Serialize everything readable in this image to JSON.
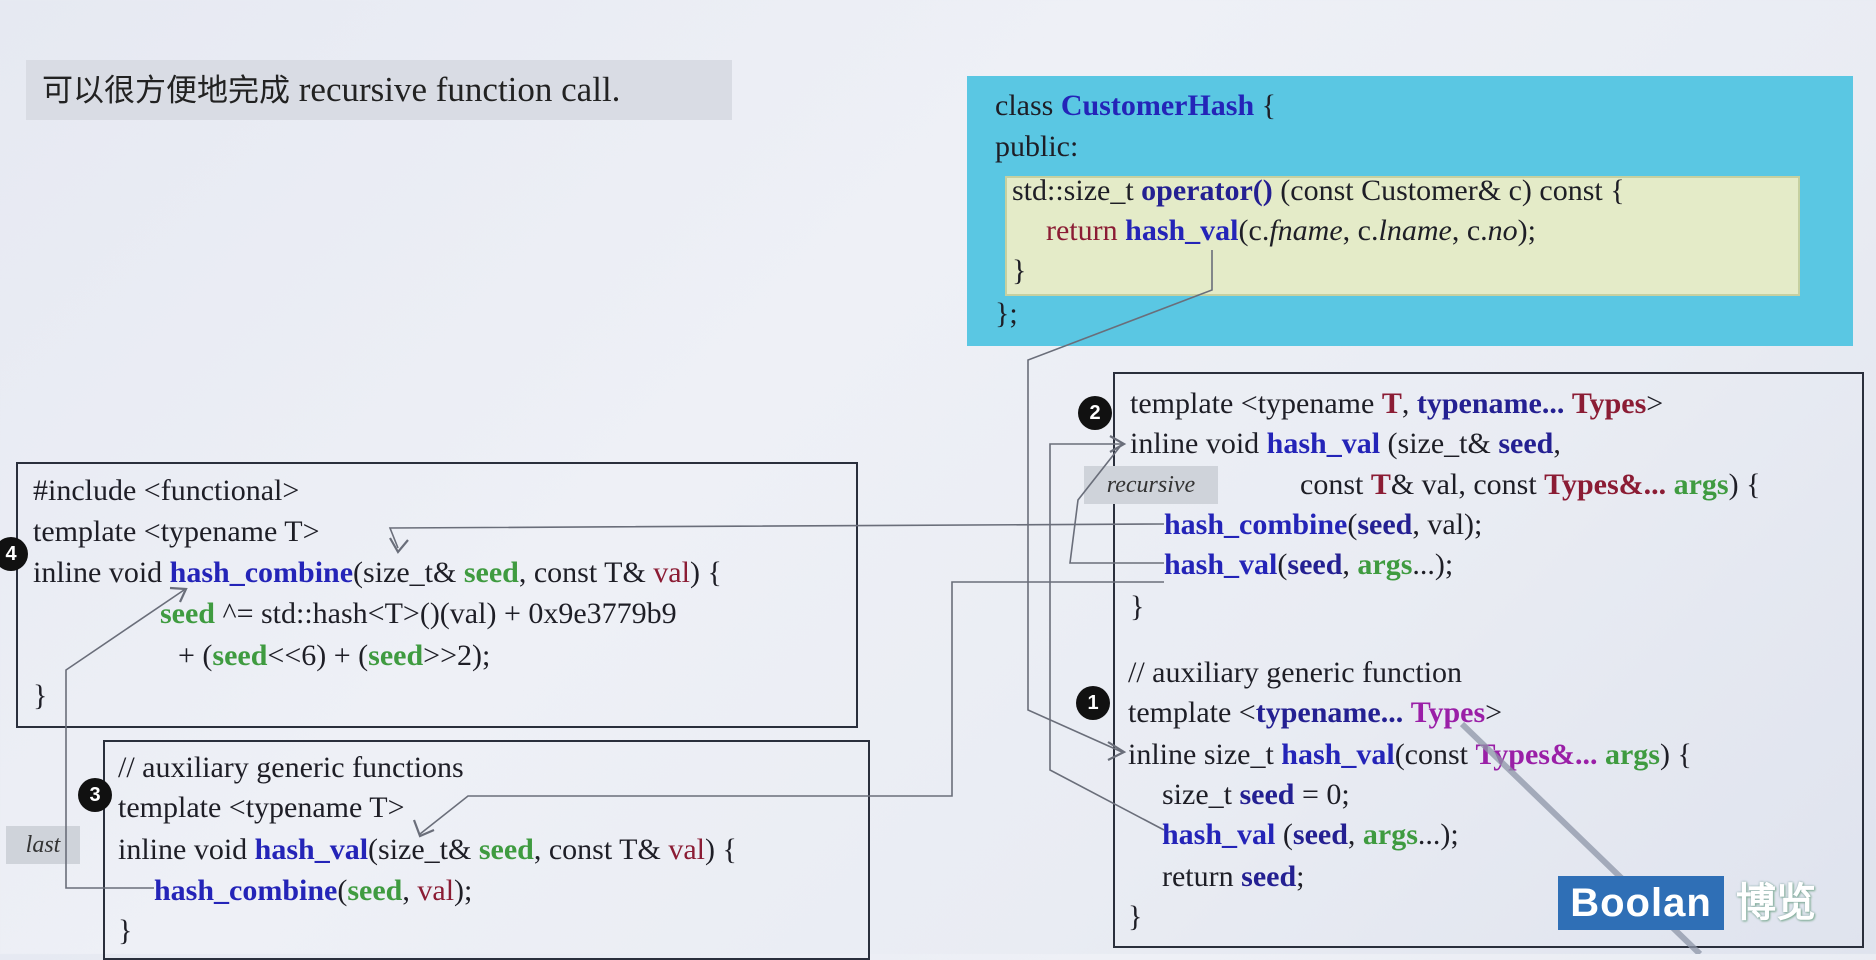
{
  "heading": {
    "cjk": "可以很方便地完成",
    "latin": " recursive function call."
  },
  "customer_hash": {
    "l1_a": "class ",
    "l1_b": "CustomerHash",
    "l1_c": " {",
    "l2": "public:",
    "l3_a": "std::size_t ",
    "l3_b": "operator()",
    "l3_c": " (const Customer& c) const {",
    "l4_a": "return ",
    "l4_b": "hash_val",
    "l4_c": "(c.",
    "l4_d": "fname",
    "l4_e": ", c.",
    "l4_f": "lname",
    "l4_g": ", c.",
    "l4_h": "no",
    "l4_i": ");",
    "l5": "}",
    "l6": "};"
  },
  "box2": {
    "badge": "2",
    "l1_a": "template <typename ",
    "l1_b": "T",
    "l1_c": ", ",
    "l1_d": "typename...",
    "l1_e": " ",
    "l1_f": "Types",
    "l1_g": ">",
    "l2_a": "inline void ",
    "l2_b": "hash_val",
    "l2_c": " (size_t& ",
    "l2_d": "seed",
    "l2_e": ",",
    "l3_a": "const ",
    "l3_b": "T",
    "l3_c": "& val, const ",
    "l3_d": "Types&...",
    "l3_e": " ",
    "l3_f": "args",
    "l3_g": ") {",
    "l4_a": "hash_combine",
    "l4_b": "(",
    "l4_c": "seed",
    "l4_d": ", val);",
    "l5_a": "hash_val",
    "l5_b": "(",
    "l5_c": "seed",
    "l5_d": ", ",
    "l5_e": "args",
    "l5_f": "...);",
    "l6": "}"
  },
  "recursive_tag": "recursive",
  "box1": {
    "badge": "1",
    "l1": "// auxiliary generic function",
    "l2_a": "template <",
    "l2_b": "typename...",
    "l2_c": " ",
    "l2_d": "Types",
    "l2_e": ">",
    "l3_a": "inline size_t ",
    "l3_b": "hash_val",
    "l3_c": "(const ",
    "l3_d": "Types&...",
    "l3_e": " ",
    "l3_f": "args",
    "l3_g": ") {",
    "l4_a": "size_t ",
    "l4_b": "seed",
    "l4_c": " = 0;",
    "l5_a": "hash_val",
    "l5_b": " (",
    "l5_c": "seed",
    "l5_d": ", ",
    "l5_e": "args",
    "l5_f": "...);",
    "l6_a": "return ",
    "l6_b": "seed",
    "l6_c": ";",
    "l7": "}"
  },
  "box4": {
    "badge": "4",
    "l1": "#include <functional>",
    "l2": "template <typename T>",
    "l3_a": "inline void ",
    "l3_b": "hash_combine",
    "l3_c": "(size_t& ",
    "l3_d": "seed",
    "l3_e": ", const T& ",
    "l3_f": "val",
    "l3_g": ") {",
    "l4_a": "seed",
    "l4_b": " ^= std::hash<T>()(val) + 0x9e3779b9",
    "l5_a": "+ (",
    "l5_b": "seed",
    "l5_c": "<<6) + (",
    "l5_d": "seed",
    "l5_e": ">>2);",
    "l6": "}"
  },
  "box3": {
    "badge": "3",
    "l1": "// auxiliary generic functions",
    "l2": "template <typename T>",
    "l3_a": "inline void ",
    "l3_b": "hash_val",
    "l3_c": "(size_t& ",
    "l3_d": "seed",
    "l3_e": ", const T& ",
    "l3_f": "val",
    "l3_g": ") {",
    "l4_a": "hash_combine",
    "l4_b": "(",
    "l4_c": "seed",
    "l4_d": ", ",
    "l4_e": "val",
    "l4_f": ");",
    "l5": "}"
  },
  "last_tag": "last",
  "logo": {
    "brand": "Boolan",
    "cn": "博览"
  }
}
